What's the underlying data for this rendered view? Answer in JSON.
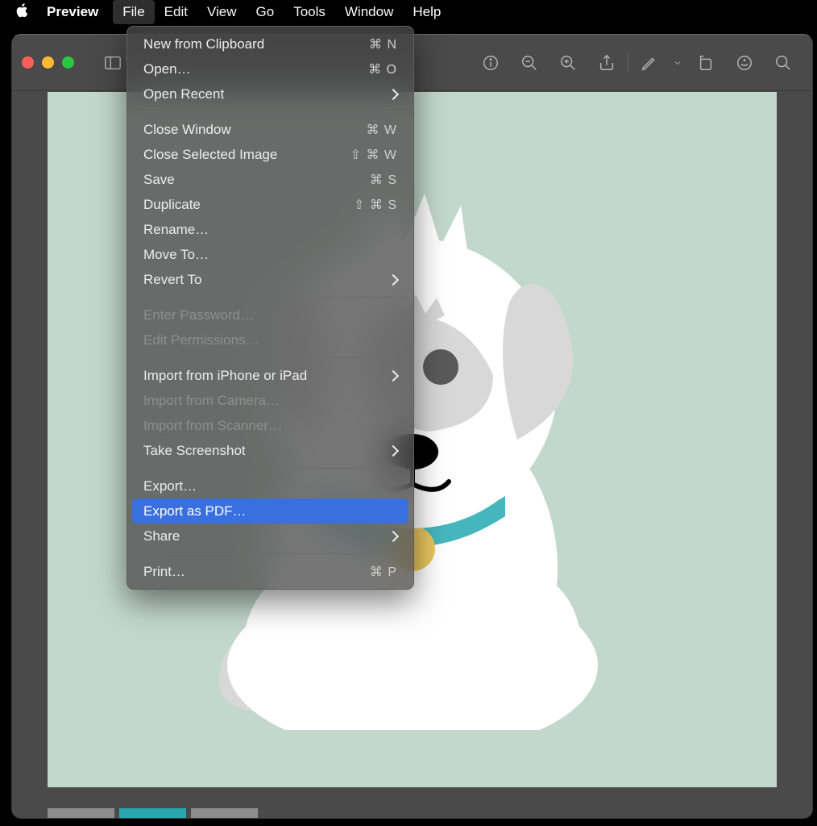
{
  "menubar": {
    "app": "Preview",
    "items": [
      "File",
      "Edit",
      "View",
      "Go",
      "Tools",
      "Window",
      "Help"
    ],
    "active_index": 0
  },
  "file_menu": {
    "groups": [
      [
        {
          "label": "New from Clipboard",
          "shortcut": "⌘ N",
          "enabled": true
        },
        {
          "label": "Open…",
          "shortcut": "⌘ O",
          "enabled": true
        },
        {
          "label": "Open Recent",
          "submenu": true,
          "enabled": true
        }
      ],
      [
        {
          "label": "Close Window",
          "shortcut": "⌘ W",
          "enabled": true
        },
        {
          "label": "Close Selected Image",
          "shortcut": "⇧ ⌘ W",
          "enabled": true
        },
        {
          "label": "Save",
          "shortcut": "⌘ S",
          "enabled": true
        },
        {
          "label": "Duplicate",
          "shortcut": "⇧ ⌘ S",
          "enabled": true
        },
        {
          "label": "Rename…",
          "enabled": true
        },
        {
          "label": "Move To…",
          "enabled": true
        },
        {
          "label": "Revert To",
          "submenu": true,
          "enabled": true
        }
      ],
      [
        {
          "label": "Enter Password…",
          "enabled": false
        },
        {
          "label": "Edit Permissions…",
          "enabled": false
        }
      ],
      [
        {
          "label": "Import from iPhone or iPad",
          "submenu": true,
          "enabled": true
        },
        {
          "label": "Import from Camera…",
          "enabled": false
        },
        {
          "label": "Import from Scanner…",
          "enabled": false
        },
        {
          "label": "Take Screenshot",
          "submenu": true,
          "enabled": true
        }
      ],
      [
        {
          "label": "Export…",
          "enabled": true
        },
        {
          "label": "Export as PDF…",
          "enabled": true,
          "highlighted": true
        },
        {
          "label": "Share",
          "submenu": true,
          "enabled": true
        }
      ],
      [
        {
          "label": "Print…",
          "shortcut": "⌘ P",
          "enabled": true
        }
      ]
    ]
  },
  "toolbar_icons": [
    "sidebar",
    "info",
    "zoom-out",
    "zoom-in",
    "share",
    "markup",
    "rotate",
    "highlight",
    "search"
  ]
}
